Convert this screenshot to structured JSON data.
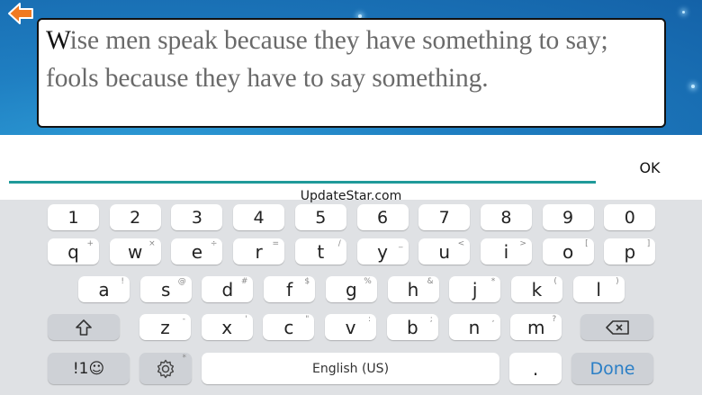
{
  "quote": {
    "first_letter": "W",
    "line1_rest": "ise men speak because they have something to say;",
    "line2": "fools because they have to say something."
  },
  "answer": {
    "value": "",
    "placeholder": ""
  },
  "ok_label": "OK",
  "watermark": "UpdateStar.com",
  "icons": {
    "back": "back-arrow-icon",
    "shift": "shift-icon",
    "backspace": "backspace-icon",
    "settings": "gear-icon",
    "emoji": "smiley-icon"
  },
  "colors": {
    "sky": "#1f7fc2",
    "arrow": "#f07a22",
    "input_underline": "#1f9a9a",
    "done": "#2b7fc6"
  },
  "keyboard": {
    "number_row": [
      "1",
      "2",
      "3",
      "4",
      "5",
      "6",
      "7",
      "8",
      "9",
      "0"
    ],
    "row1": [
      {
        "key": "q",
        "sub": "+"
      },
      {
        "key": "w",
        "sub": "×"
      },
      {
        "key": "e",
        "sub": "÷"
      },
      {
        "key": "r",
        "sub": "="
      },
      {
        "key": "t",
        "sub": "/"
      },
      {
        "key": "y",
        "sub": "_"
      },
      {
        "key": "u",
        "sub": "<"
      },
      {
        "key": "i",
        "sub": ">"
      },
      {
        "key": "o",
        "sub": "["
      },
      {
        "key": "p",
        "sub": "]"
      }
    ],
    "row2": [
      {
        "key": "a",
        "sub": "!"
      },
      {
        "key": "s",
        "sub": "@"
      },
      {
        "key": "d",
        "sub": "#"
      },
      {
        "key": "f",
        "sub": "$"
      },
      {
        "key": "g",
        "sub": "%"
      },
      {
        "key": "h",
        "sub": "&"
      },
      {
        "key": "j",
        "sub": "*"
      },
      {
        "key": "k",
        "sub": "("
      },
      {
        "key": "l",
        "sub": ")"
      }
    ],
    "row3": [
      {
        "key": "z",
        "sub": "-"
      },
      {
        "key": "x",
        "sub": "'"
      },
      {
        "key": "c",
        "sub": "\""
      },
      {
        "key": "v",
        "sub": ":"
      },
      {
        "key": "b",
        "sub": ";"
      },
      {
        "key": "n",
        "sub": ","
      },
      {
        "key": "m",
        "sub": "?"
      }
    ],
    "symbols_label": "!1☺",
    "space_label": "English (US)",
    "period_label": ".",
    "done_label": "Done",
    "settings_sub": "*"
  }
}
